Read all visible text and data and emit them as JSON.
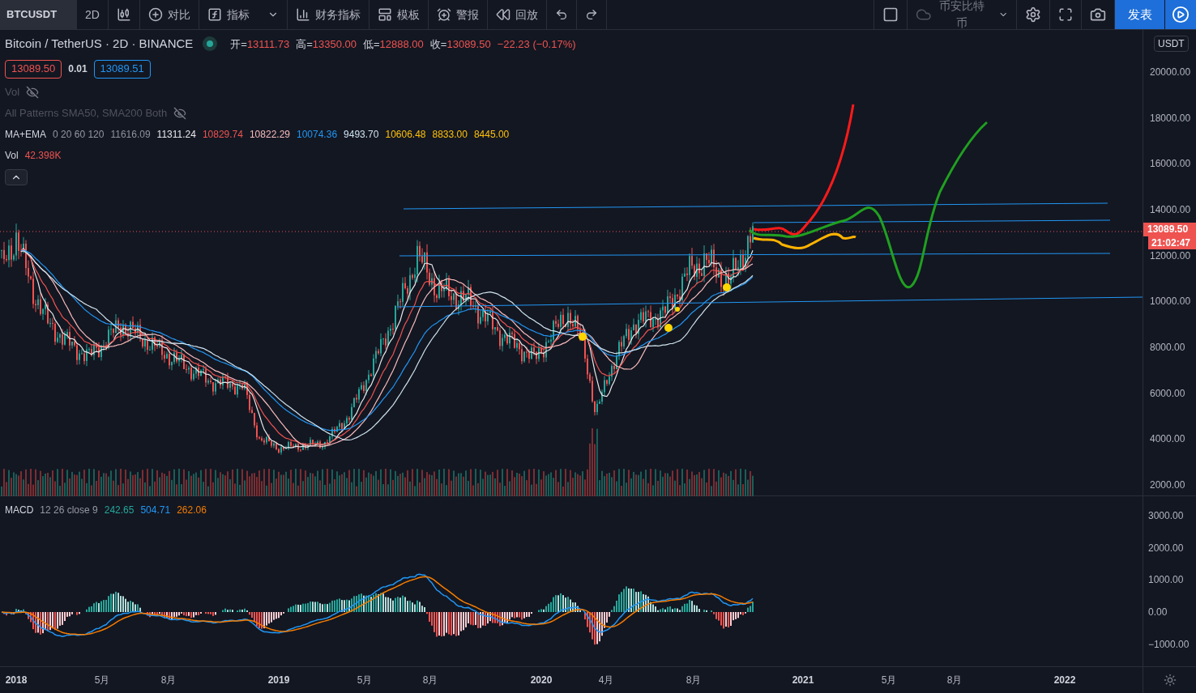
{
  "toolbar": {
    "symbol": "BTCUSDT",
    "interval": "2D",
    "tools": [
      {
        "label": "对比"
      },
      {
        "label": "指标"
      },
      {
        "label": "财务指标"
      },
      {
        "label": "模板"
      },
      {
        "label": "警报"
      },
      {
        "label": "回放"
      }
    ],
    "layout_name": "币安比特币",
    "publish": "发表"
  },
  "legend": {
    "title": "Bitcoin / TetherUS · 2D · BINANCE",
    "market_open": true,
    "ohlc": [
      {
        "label": "开=",
        "value": "13111.73"
      },
      {
        "label": "高=",
        "value": "13350.00"
      },
      {
        "label": "低=",
        "value": "12888.00"
      },
      {
        "label": "收=",
        "value": "13089.50"
      }
    ],
    "change": "−22.23 (−0.17%)",
    "bid": "13089.50",
    "spread": "0.01",
    "ask": "13089.51",
    "indicators": [
      {
        "kind": "hidden",
        "name": "Vol",
        "visible": false
      },
      {
        "kind": "hidden",
        "name": "All Patterns SMA50, SMA200 Both",
        "visible": false
      },
      {
        "kind": "values",
        "name": "MA+EMA",
        "params": "0 20 60 120",
        "visible": true,
        "values": [
          {
            "text": "11616.09",
            "color": "#8f929b"
          },
          {
            "text": "11311.24",
            "color": "#e8e8ea"
          },
          {
            "text": "10829.74",
            "color": "#ef5350"
          },
          {
            "text": "10822.29",
            "color": "#f8bbbb"
          },
          {
            "text": "10074.36",
            "color": "#2196f3"
          },
          {
            "text": "9493.70",
            "color": "#cfe3ee"
          },
          {
            "text": "10606.48",
            "color": "#ffc107"
          },
          {
            "text": "8833.00",
            "color": "#ffc107"
          },
          {
            "text": "8445.00",
            "color": "#ffc107"
          }
        ]
      },
      {
        "kind": "values",
        "name": "Vol",
        "visible": true,
        "values": [
          {
            "text": "42.398K",
            "color": "#ef5350"
          }
        ]
      }
    ]
  },
  "price_axis": {
    "currency": "USDT",
    "ticks": [
      "20000.00",
      "18000.00",
      "16000.00",
      "14000.00",
      "12000.00",
      "10000.00",
      "8000.00",
      "6000.00",
      "4000.00",
      "2000.00"
    ],
    "last_price": "13089.50",
    "countdown": "21:02:47"
  },
  "macd": {
    "name": "MACD",
    "params": "12 26 close 9",
    "values": [
      {
        "text": "242.65",
        "color": "#26a69a"
      },
      {
        "text": "504.71",
        "color": "#2196f3"
      },
      {
        "text": "262.06",
        "color": "#f57c00"
      }
    ],
    "ticks": [
      "3000.00",
      "2000.00",
      "1000.00",
      "0.00",
      "−1000.00"
    ]
  },
  "time_axis": [
    {
      "label": "2018",
      "kind": "year"
    },
    {
      "label": "5月",
      "kind": "month"
    },
    {
      "label": "8月",
      "kind": "month"
    },
    {
      "label": "2019",
      "kind": "year"
    },
    {
      "label": "5月",
      "kind": "month"
    },
    {
      "label": "8月",
      "kind": "month"
    },
    {
      "label": "2020",
      "kind": "year"
    },
    {
      "label": "4月",
      "kind": "month"
    },
    {
      "label": "8月",
      "kind": "month"
    },
    {
      "label": "2021",
      "kind": "year"
    },
    {
      "label": "5月",
      "kind": "month"
    },
    {
      "label": "8月",
      "kind": "month"
    },
    {
      "label": "2022",
      "kind": "year"
    }
  ]
}
